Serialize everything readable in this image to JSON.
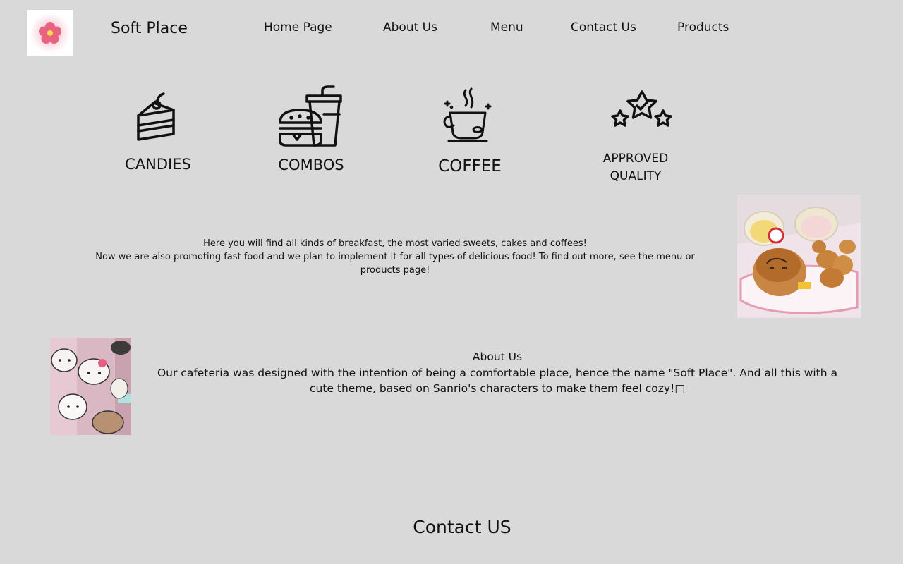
{
  "header": {
    "brand": "Soft Place",
    "logo_icon": "flower-icon",
    "nav": [
      "Home Page",
      "About Us",
      "Menu",
      "Contact Us",
      "Products"
    ]
  },
  "features": [
    {
      "label": "CANDIES",
      "icon": "cake-slice-icon"
    },
    {
      "label": "COMBOS",
      "icon": "burger-drink-icon"
    },
    {
      "label": "COFFEE",
      "icon": "coffee-cup-icon"
    },
    {
      "label": "APPROVED QUALITY",
      "icon": "stars-rating-icon"
    }
  ],
  "intro": {
    "line1": "Here you will find all kinds of breakfast, the most varied sweets, cakes and coffees!",
    "line2": "Now we are also promoting fast food and we plan to implement it for all types of delicious food! To find out more, see the menu or products page!"
  },
  "about": {
    "title": "About Us",
    "body": "Our cafeteria was designed with the intention of being a comfortable place, hence the name \"Soft Place\". And all this with a cute theme, based on Sanrio's characters to make them feel cozy!□"
  },
  "contact": {
    "title": "Contact US"
  },
  "colors": {
    "background": "#d9d9d9",
    "text": "#111111",
    "flower": "#e8637f"
  }
}
